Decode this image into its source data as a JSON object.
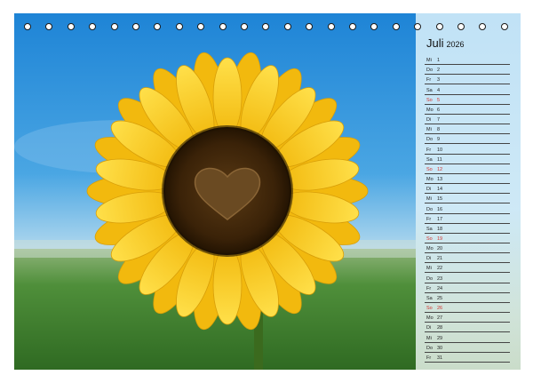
{
  "calendar": {
    "month": "Juli",
    "year": "2026",
    "days": [
      {
        "name": "Mi",
        "num": "1",
        "sunday": false
      },
      {
        "name": "Do",
        "num": "2",
        "sunday": false
      },
      {
        "name": "Fr",
        "num": "3",
        "sunday": false
      },
      {
        "name": "Sa",
        "num": "4",
        "sunday": false
      },
      {
        "name": "So",
        "num": "5",
        "sunday": true
      },
      {
        "name": "Mo",
        "num": "6",
        "sunday": false
      },
      {
        "name": "Di",
        "num": "7",
        "sunday": false
      },
      {
        "name": "Mi",
        "num": "8",
        "sunday": false
      },
      {
        "name": "Do",
        "num": "9",
        "sunday": false
      },
      {
        "name": "Fr",
        "num": "10",
        "sunday": false
      },
      {
        "name": "Sa",
        "num": "11",
        "sunday": false
      },
      {
        "name": "So",
        "num": "12",
        "sunday": true
      },
      {
        "name": "Mo",
        "num": "13",
        "sunday": false
      },
      {
        "name": "Di",
        "num": "14",
        "sunday": false
      },
      {
        "name": "Mi",
        "num": "15",
        "sunday": false
      },
      {
        "name": "Do",
        "num": "16",
        "sunday": false
      },
      {
        "name": "Fr",
        "num": "17",
        "sunday": false
      },
      {
        "name": "Sa",
        "num": "18",
        "sunday": false
      },
      {
        "name": "So",
        "num": "19",
        "sunday": true
      },
      {
        "name": "Mo",
        "num": "20",
        "sunday": false
      },
      {
        "name": "Di",
        "num": "21",
        "sunday": false
      },
      {
        "name": "Mi",
        "num": "22",
        "sunday": false
      },
      {
        "name": "Do",
        "num": "23",
        "sunday": false
      },
      {
        "name": "Fr",
        "num": "24",
        "sunday": false
      },
      {
        "name": "Sa",
        "num": "25",
        "sunday": false
      },
      {
        "name": "So",
        "num": "26",
        "sunday": true
      },
      {
        "name": "Mo",
        "num": "27",
        "sunday": false
      },
      {
        "name": "Di",
        "num": "28",
        "sunday": false
      },
      {
        "name": "Mi",
        "num": "29",
        "sunday": false
      },
      {
        "name": "Do",
        "num": "30",
        "sunday": false
      },
      {
        "name": "Fr",
        "num": "31",
        "sunday": false
      }
    ]
  },
  "colors": {
    "sunday": "#d2322d",
    "petal": "#f7c81a",
    "sky": "#2f8fd8",
    "grass": "#4f8f3a"
  },
  "photo": {
    "subject": "sunflower-with-heart-center"
  }
}
